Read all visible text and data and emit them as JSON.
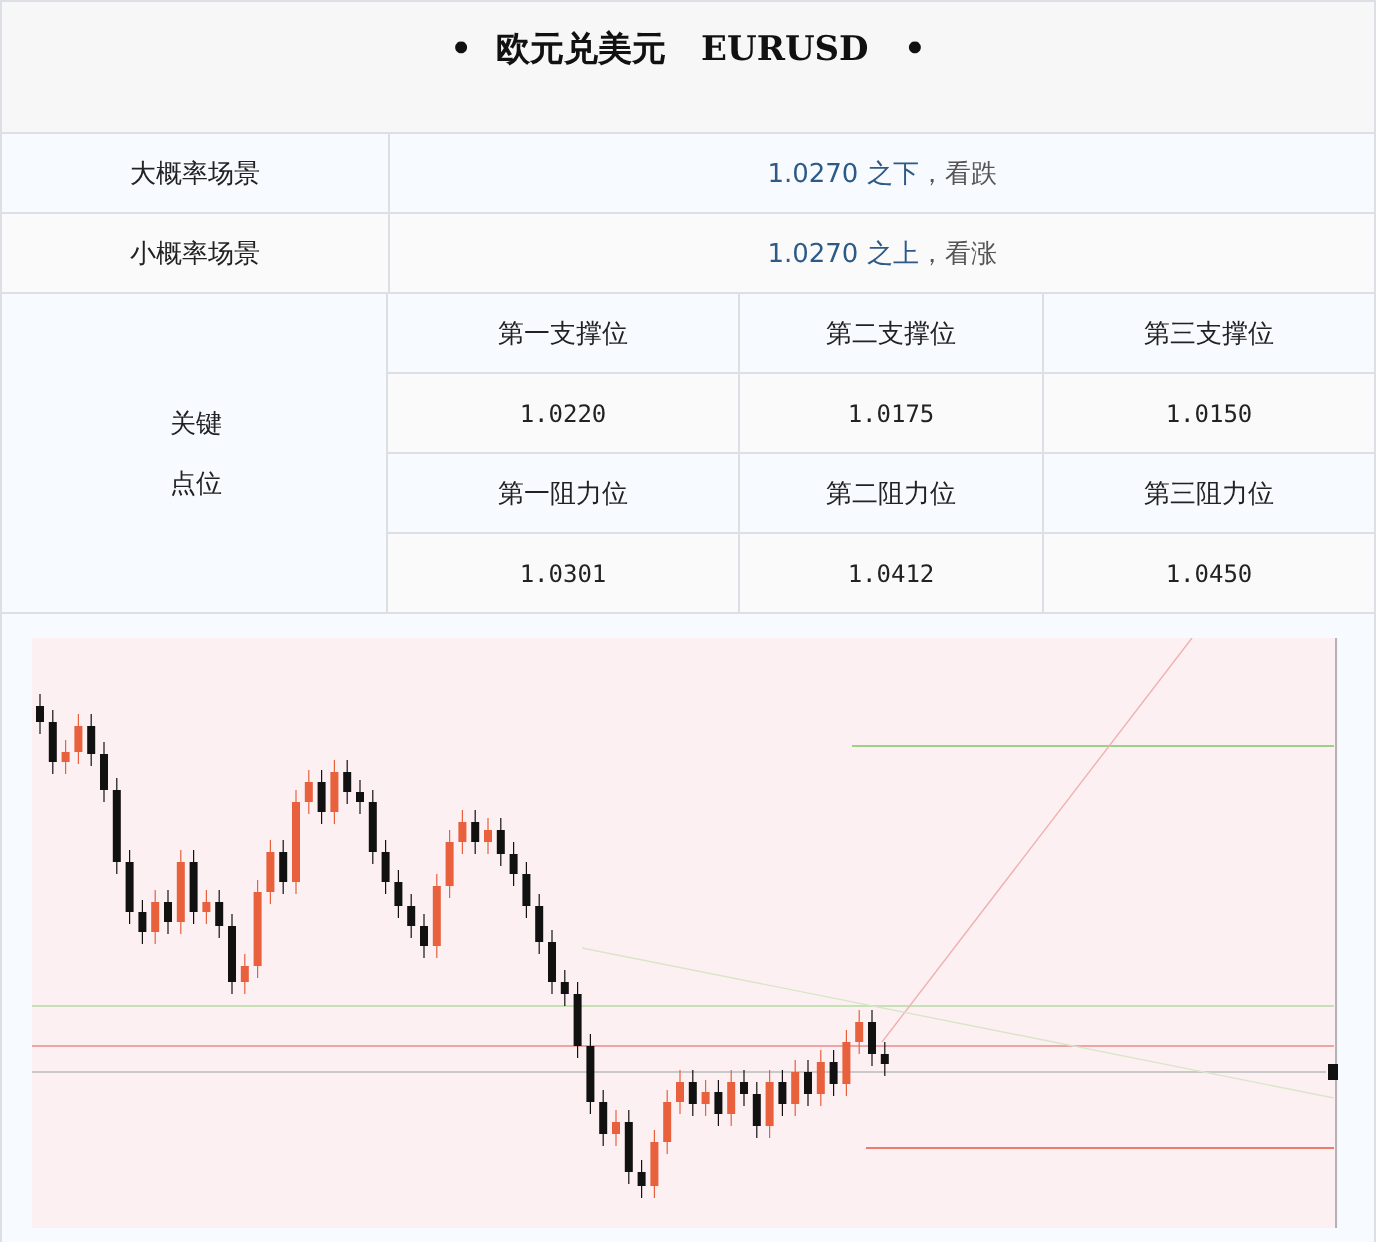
{
  "title": "•  欧元兑美元   EURUSD   •",
  "scenarios": [
    {
      "label": "大概率场景",
      "condition": "1.0270 之下",
      "outlook": "，看跌"
    },
    {
      "label": "小概率场景",
      "condition": "1.0270 之上",
      "outlook": "，看涨"
    }
  ],
  "key_levels": {
    "label_lines": [
      "关键",
      "点位"
    ],
    "groups": [
      {
        "headers": [
          "第一支撑位",
          "第二支撑位",
          "第三支撑位"
        ],
        "values": [
          "1.0220",
          "1.0175",
          "1.0150"
        ]
      },
      {
        "headers": [
          "第一阻力位",
          "第二阻力位",
          "第三阻力位"
        ],
        "values": [
          "1.0301",
          "1.0412",
          "1.0450"
        ]
      }
    ]
  }
}
